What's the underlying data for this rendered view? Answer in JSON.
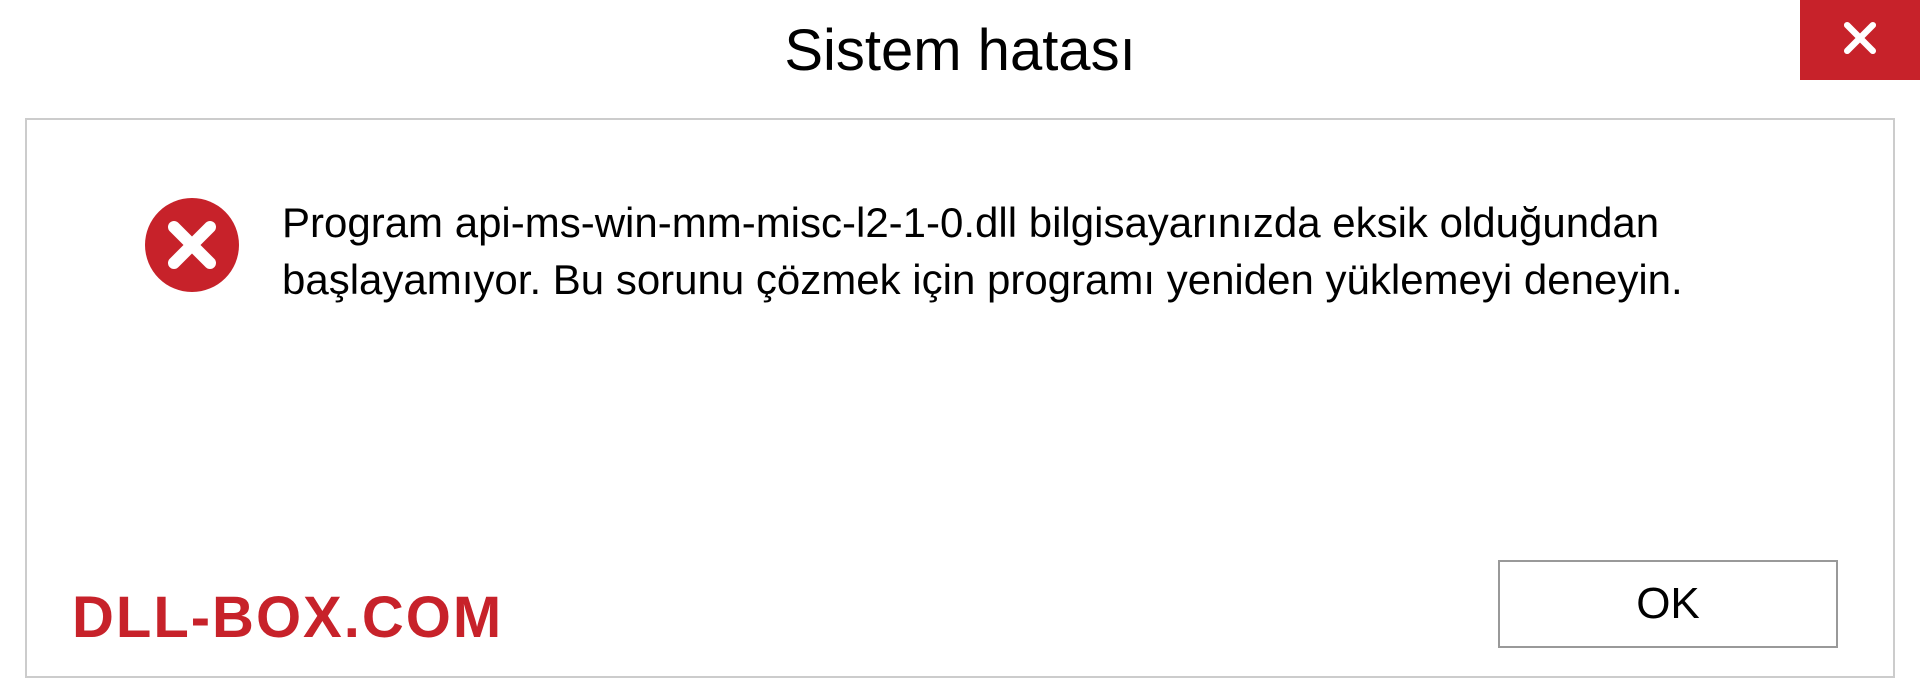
{
  "dialog": {
    "title": "Sistem hatası",
    "message": "Program api-ms-win-mm-misc-l2-1-0.dll bilgisayarınızda eksik olduğundan başlayamıyor. Bu sorunu çözmek için programı yeniden yüklemeyi deneyin.",
    "ok_label": "OK"
  },
  "watermark": {
    "text": "DLL-BOX.COM"
  }
}
